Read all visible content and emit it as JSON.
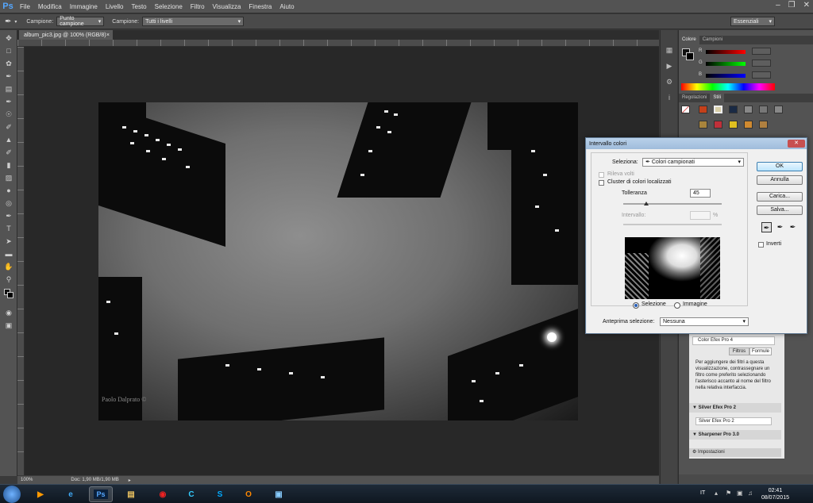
{
  "app": {
    "logo": "Ps"
  },
  "menu": [
    "File",
    "Modifica",
    "Immagine",
    "Livello",
    "Testo",
    "Selezione",
    "Filtro",
    "Visualizza",
    "Finestra",
    "Aiuto"
  ],
  "options": {
    "sample_label": "Campione:",
    "sample_value": "Punto campione",
    "layers_label": "Campione:",
    "layers_value": "Tutti i livelli",
    "workspace": "Essenziali"
  },
  "document": {
    "tab_title": "album_pic3.jpg @ 100% (RGB/8)",
    "zoom": "100%",
    "doc_size": "Doc: 1,90 MB/1,90 MB",
    "watermark": "Paolo Dalprato ©"
  },
  "panels": {
    "color_tabs": [
      "Colore",
      "Campioni"
    ],
    "color_channels": [
      "R",
      "G",
      "B"
    ],
    "adjust_tabs": [
      "Regolazioni",
      "Stili"
    ],
    "filter_panel": {
      "item1": "Color Efex Pro 4",
      "tabs": [
        "Filtros",
        "Formule"
      ],
      "help_text": "Per aggiungere dei filtri a questa visualizzazione, contrassegnare un filtro come preferito selezionando l'asterisco accanto al nome del filtro nella relativa interfaccia.",
      "section2": "Silver Efex Pro 2",
      "item2": "Silver Efex Pro 2",
      "section3": "Sharpener Pro 3.0",
      "settings": "Impostazioni"
    }
  },
  "dialog": {
    "title": "Intervallo colori",
    "selection_label": "Seleziona:",
    "selection_value": "Colori campionati",
    "detect_faces": "Rileva volti",
    "localized_clusters": "Cluster di colori localizzati",
    "tolerance_label": "Tolleranza",
    "tolerance_value": "45",
    "range_label": "Intervallo:",
    "range_unit": "%",
    "radio_selection": "Selezione",
    "radio_image": "Immagine",
    "preview_label": "Anteprima selezione:",
    "preview_value": "Nessuna",
    "buttons": {
      "ok": "OK",
      "cancel": "Annulla",
      "load": "Carica...",
      "save": "Salva..."
    },
    "invert": "Inverti",
    "tolerance_fraction": 0.23
  },
  "taskbar": {
    "lang": "IT",
    "time": "02:41",
    "date": "08/07/2015"
  }
}
